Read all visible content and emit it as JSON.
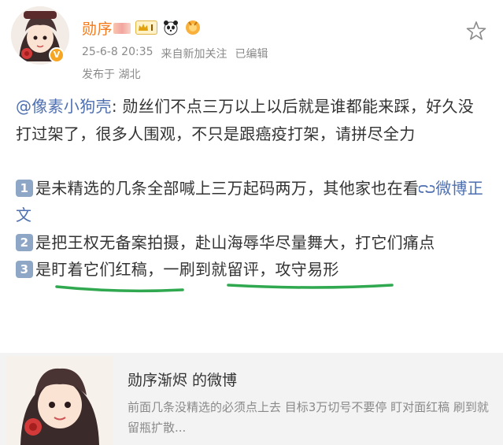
{
  "post": {
    "author": {
      "name": "勋序",
      "level_label": "I"
    },
    "meta": {
      "datetime": "25-6-8 20:35",
      "source": "来自新加关注",
      "edited": "已编辑"
    },
    "location": "发布于 湖北",
    "body": {
      "mention": "@像素小狗壳",
      "intro": ": 勋丝们不点三万以上以后就是谁都能来踩，好久没打过架了，很多人围观，不只是跟癌疫打架，请拼尽全力",
      "items": [
        {
          "number": "1",
          "text": "是未精选的几条全部喊上三万起码两万，其他家也在看",
          "link": "微博正文"
        },
        {
          "number": "2",
          "text_a": "是把王权无备案拍摄",
          "sep": "，",
          "text_b": "赴山海辱华尽量舞大",
          "text_c": "，打它们痛点"
        },
        {
          "number": "3",
          "text": "是盯着它们红稿，一刷到就留评，攻守易形"
        }
      ]
    },
    "card": {
      "title": "勋序渐烬 的微博",
      "description": "前面几条没精选的必须点上去 目标3万切号不要停 盯对面红稿 刷到就留瓶扩散..."
    }
  },
  "colors": {
    "author": "#f37b1d",
    "link": "#4e6fb0",
    "underline": "#2fa84f",
    "number_box": "#8fa7c6"
  }
}
